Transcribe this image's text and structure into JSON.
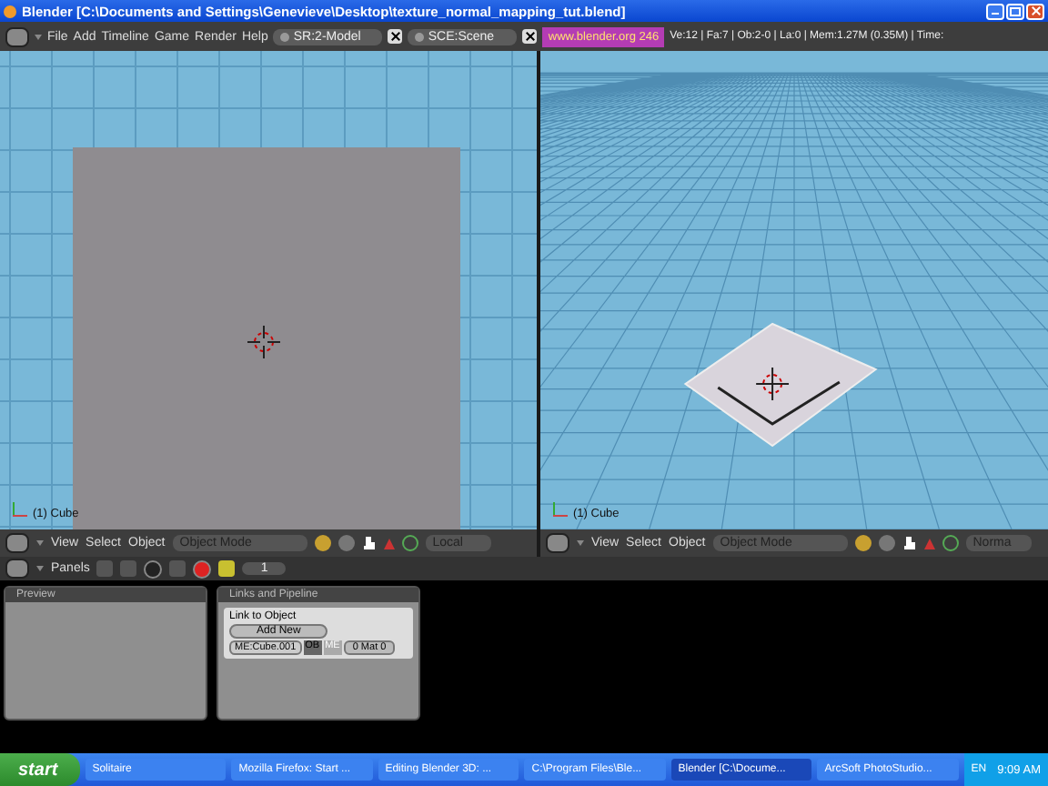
{
  "window": {
    "title": "Blender [C:\\Documents and Settings\\Genevieve\\Desktop\\texture_normal_mapping_tut.blend]"
  },
  "info_header": {
    "menus": [
      "File",
      "Add",
      "Timeline",
      "Game",
      "Render",
      "Help"
    ],
    "screen": "SR:2-Model",
    "scene": "SCE:Scene",
    "website": "www.blender.org 246",
    "stats": "Ve:12 | Fa:7 | Ob:2-0 | La:0 | Mem:1.27M (0.35M) | Time:"
  },
  "viewports": [
    {
      "kind": "ortho",
      "object_label": "(1) Cube",
      "menus": [
        "View",
        "Select",
        "Object"
      ],
      "mode": "Object Mode",
      "orientation": "Local"
    },
    {
      "kind": "perspective",
      "object_label": "(1) Cube",
      "menus": [
        "View",
        "Select",
        "Object"
      ],
      "mode": "Object Mode",
      "orientation": "Norma"
    }
  ],
  "buttons_header": {
    "label": "Panels",
    "frame": "1"
  },
  "panels": [
    {
      "title": "Preview",
      "kind": "preview"
    },
    {
      "title": "Links and Pipeline",
      "kind": "links",
      "link_label": "Link to Object",
      "add_button": "Add New",
      "mesh_field": "ME:Cube.001",
      "toggles": [
        {
          "label": "OB",
          "selected": false
        },
        {
          "label": "ME",
          "selected": true
        }
      ],
      "material_field": "0 Mat 0"
    }
  ],
  "taskbar": {
    "start": "start",
    "tasks": [
      {
        "label": "Solitaire",
        "selected": false
      },
      {
        "label": "Mozilla Firefox: Start ...",
        "selected": false
      },
      {
        "label": "Editing Blender 3D: ...",
        "selected": false
      },
      {
        "label": "C:\\Program Files\\Ble...",
        "selected": false
      },
      {
        "label": "Blender [C:\\Docume...",
        "selected": true
      },
      {
        "label": "ArcSoft PhotoStudio...",
        "selected": false
      }
    ],
    "language": "EN",
    "clock": "9:09 AM"
  }
}
